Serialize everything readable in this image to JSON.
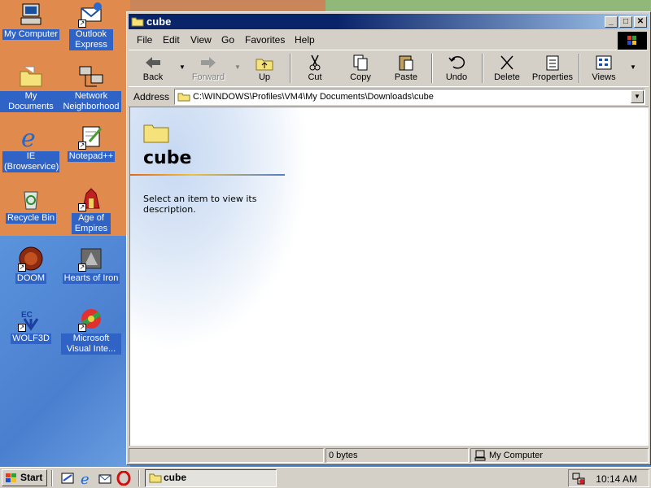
{
  "desktop": {
    "icons": [
      {
        "label": "My Computer"
      },
      {
        "label": "Outlook Express"
      },
      {
        "label": "My Documents"
      },
      {
        "label": "Network Neighborhood"
      },
      {
        "label": "IE (Browservice)"
      },
      {
        "label": "Notepad++"
      },
      {
        "label": "Recycle Bin"
      },
      {
        "label": "Age of Empires"
      },
      {
        "label": "DOOM"
      },
      {
        "label": "Hearts of Iron"
      },
      {
        "label": "WOLF3D"
      },
      {
        "label": "Microsoft Visual Inte..."
      }
    ]
  },
  "window": {
    "title": "cube",
    "menu": [
      "File",
      "Edit",
      "View",
      "Go",
      "Favorites",
      "Help"
    ],
    "toolbar": {
      "back": "Back",
      "forward": "Forward",
      "up": "Up",
      "cut": "Cut",
      "copy": "Copy",
      "paste": "Paste",
      "undo": "Undo",
      "delete": "Delete",
      "properties": "Properties",
      "views": "Views"
    },
    "address": {
      "label": "Address",
      "value": "C:\\WINDOWS\\Profiles\\VM4\\My Documents\\Downloads\\cube"
    },
    "content": {
      "folder_name": "cube",
      "description": "Select an item to view its description."
    },
    "status": {
      "size": "0 bytes",
      "zone": "My Computer"
    }
  },
  "taskbar": {
    "start_label": "Start",
    "task_label": "cube",
    "clock": "10:14 AM"
  },
  "colors": {
    "titlebar": "#0a246a",
    "desktop_blue": "#4a7fcf",
    "desktop_orange": "#e08b4d",
    "chrome": "#d4d0c8"
  }
}
